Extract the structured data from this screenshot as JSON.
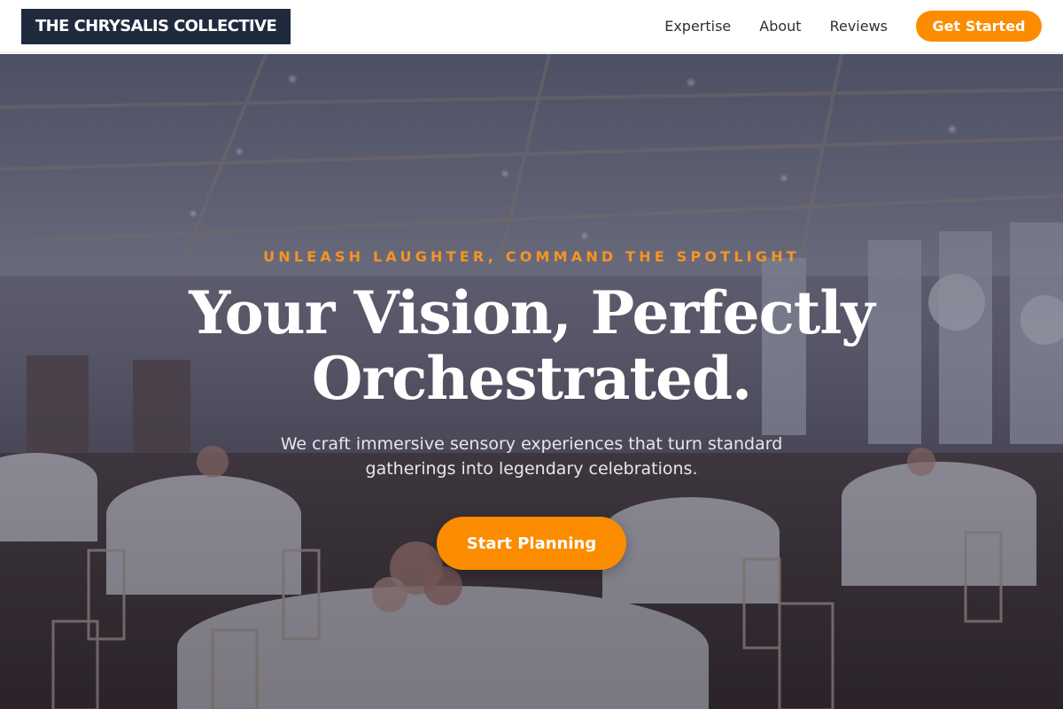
{
  "brand": {
    "name": "THE CHRYSALIS COLLECTIVE"
  },
  "nav": {
    "links": [
      {
        "label": "Expertise"
      },
      {
        "label": "About"
      },
      {
        "label": "Reviews"
      }
    ],
    "cta_label": "Get Started"
  },
  "hero": {
    "eyebrow": "UNLEASH LAUGHTER, COMMAND THE SPOTLIGHT",
    "headline_line1": "Your Vision, Perfectly",
    "headline_line2": "Orchestrated.",
    "subhead_line1": "We craft immersive sensory experiences that turn standard",
    "subhead_line2": "gatherings into legendary celebrations.",
    "cta_label": "Start Planning",
    "background_image": "banquet-hall-photo"
  },
  "colors": {
    "accent": "#fb8c00",
    "eyebrow": "#f59423",
    "logo_bg": "#1f2a3d",
    "nav_text": "#2b2f36"
  }
}
